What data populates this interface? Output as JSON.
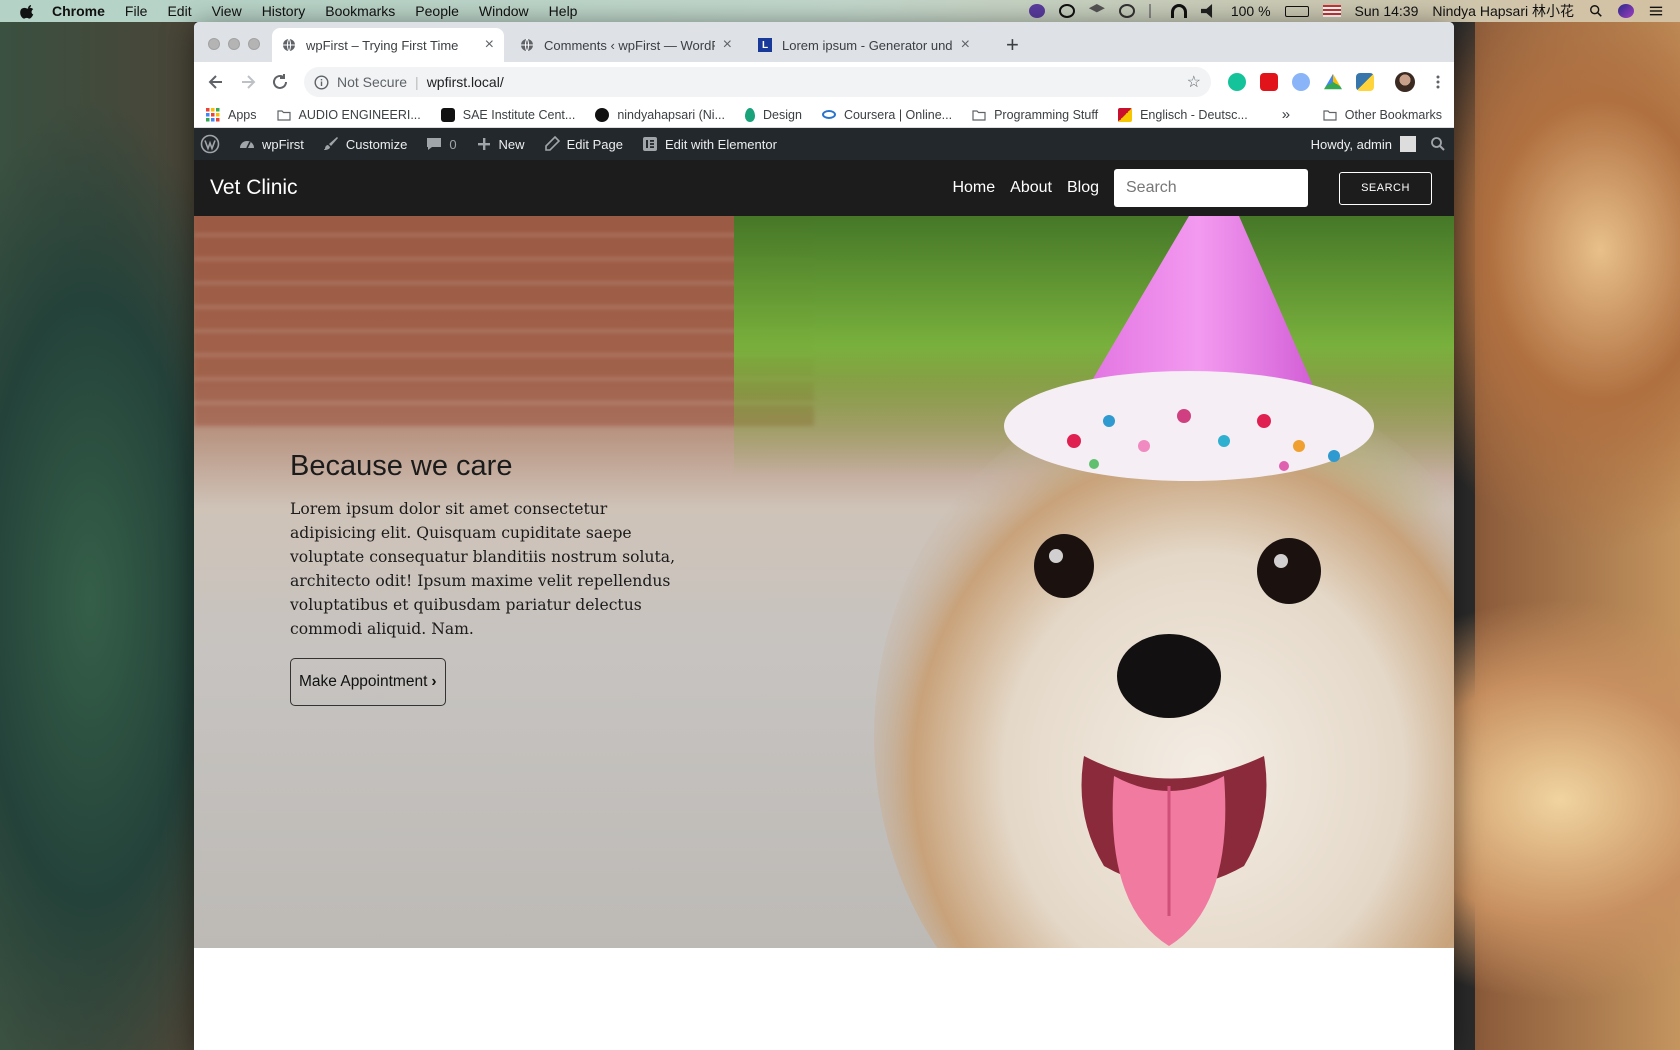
{
  "menubar": {
    "app": "Chrome",
    "items": [
      "File",
      "Edit",
      "View",
      "History",
      "Bookmarks",
      "People",
      "Window",
      "Help"
    ],
    "battery": "100 %",
    "clock": "Sun 14:39",
    "user": "Nindya Hapsari 林小花"
  },
  "browser": {
    "tabs": [
      {
        "title": "wpFirst – Trying First Time",
        "active": true
      },
      {
        "title": "Comments ‹ wpFirst — WordPr",
        "active": false
      },
      {
        "title": "Lorem ipsum - Generator und I",
        "active": false
      }
    ],
    "security": "Not Secure",
    "url": "wpfirst.local/",
    "bookmarks": [
      "Apps",
      "AUDIO ENGINEERI...",
      "SAE Institute Cent...",
      "nindyahapsari (Ni...",
      "Design",
      "Coursera | Online...",
      "Programming Stuff",
      "Englisch - Deutsc..."
    ],
    "more": "»",
    "other_bookmarks": "Other Bookmarks"
  },
  "adminbar": {
    "site": "wpFirst",
    "customize": "Customize",
    "comments": "0",
    "new": "New",
    "edit_page": "Edit Page",
    "elementor": "Edit with Elementor",
    "howdy": "Howdy, admin"
  },
  "site": {
    "brand": "Vet Clinic",
    "nav": [
      "Home",
      "About",
      "Blog"
    ],
    "search_placeholder": "Search",
    "search_button": "SEARCH"
  },
  "hero": {
    "title": "Because we care",
    "text": "Lorem ipsum dolor sit amet consectetur adipisicing elit. Quisquam cupiditate saepe voluptate consequatur blanditiis nostrum soluta, architecto odit! Ipsum maxime velit repellendus voluptatibus et quibusdam pariatur delectus commodi aliquid. Nam.",
    "cta": "Make Appointment"
  }
}
